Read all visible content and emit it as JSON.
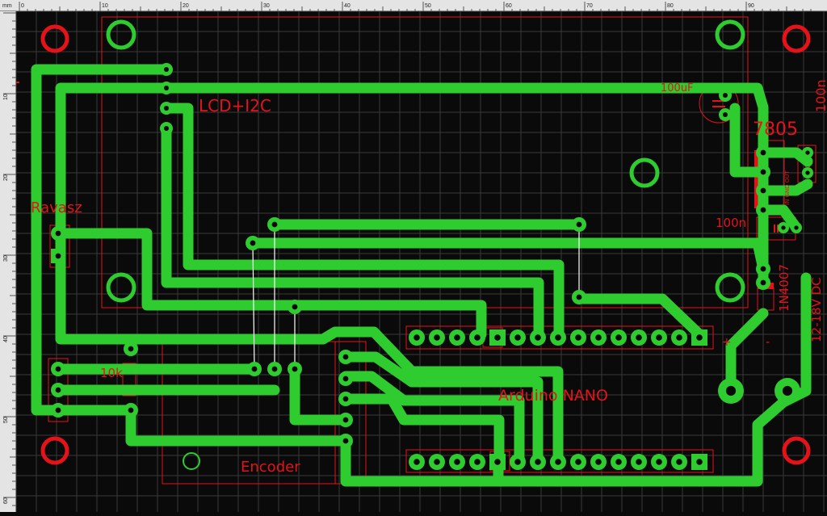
{
  "ruler": {
    "unit": "mm",
    "x_ticks": [
      "0",
      "10",
      "20",
      "30",
      "40",
      "50",
      "60",
      "70",
      "80",
      "90"
    ],
    "y_ticks": [
      "10",
      "20",
      "30",
      "40",
      "50",
      "60"
    ]
  },
  "labels": {
    "lcd": "LCD+I2C",
    "ravasz": "Ravasz",
    "cap_100uf": "100uF",
    "regulator": "7805",
    "cap_100n_top": "100n",
    "cap_100n_mid": "100n",
    "resistor": "10k",
    "diode": "1N4007",
    "arduino": "Arduino NANO",
    "encoder": "Encoder",
    "power": "12-18V DC",
    "plus": "+",
    "minus": "-",
    "reg_pins": "IN GND OUT"
  },
  "colors": {
    "background": "#0a0a0a",
    "grid": "#3a3a3a",
    "copper": "#2ecc2e",
    "silkscreen": "#e5121a",
    "jumper": "#ffffff",
    "ruler": "#e4e4e4"
  }
}
